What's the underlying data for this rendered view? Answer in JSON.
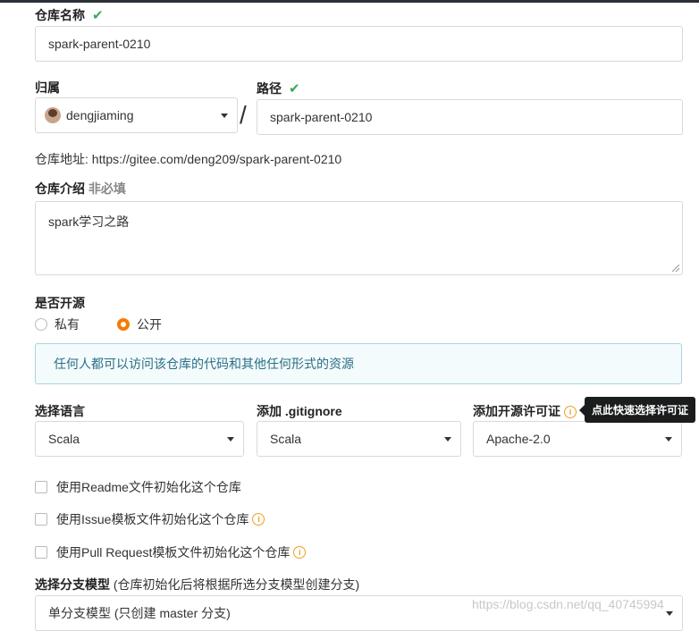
{
  "repo_name": {
    "label": "仓库名称",
    "value": "spark-parent-0210"
  },
  "owner": {
    "label": "归属",
    "value": "dengjiaming"
  },
  "path": {
    "label": "路径",
    "value": "spark-parent-0210",
    "separator": "/"
  },
  "repo_url": {
    "label": "仓库地址:",
    "value": "https://gitee.com/deng209/spark-parent-0210"
  },
  "description": {
    "label": "仓库介绍",
    "optional": "非必填",
    "value": "spark学习之路"
  },
  "visibility": {
    "label": "是否开源",
    "options": [
      {
        "label": "私有",
        "selected": false
      },
      {
        "label": "公开",
        "selected": true
      }
    ],
    "notice": "任何人都可以访问该仓库的代码和其他任何形式的资源"
  },
  "language": {
    "label": "选择语言",
    "value": "Scala"
  },
  "gitignore": {
    "label": "添加 .gitignore",
    "value": "Scala"
  },
  "license": {
    "label": "添加开源许可证",
    "value": "Apache-2.0",
    "tooltip": "点此快速选择许可证"
  },
  "init_options": [
    {
      "label": "使用Readme文件初始化这个仓库",
      "checked": false,
      "info": false
    },
    {
      "label": "使用Issue模板文件初始化这个仓库",
      "checked": false,
      "info": true
    },
    {
      "label": "使用Pull Request模板文件初始化这个仓库",
      "checked": false,
      "info": true
    }
  ],
  "branch_model": {
    "label": "选择分支模型",
    "hint": "(仓库初始化后将根据所选分支模型创建分支)",
    "value": "单分支模型 (只创建 master 分支)"
  },
  "watermark": "https://blog.csdn.net/qq_40745994",
  "colors": {
    "accent": "#f57c00",
    "success": "#3aa757",
    "notice_bg": "#f4fbfc",
    "notice_text": "#276f86"
  }
}
